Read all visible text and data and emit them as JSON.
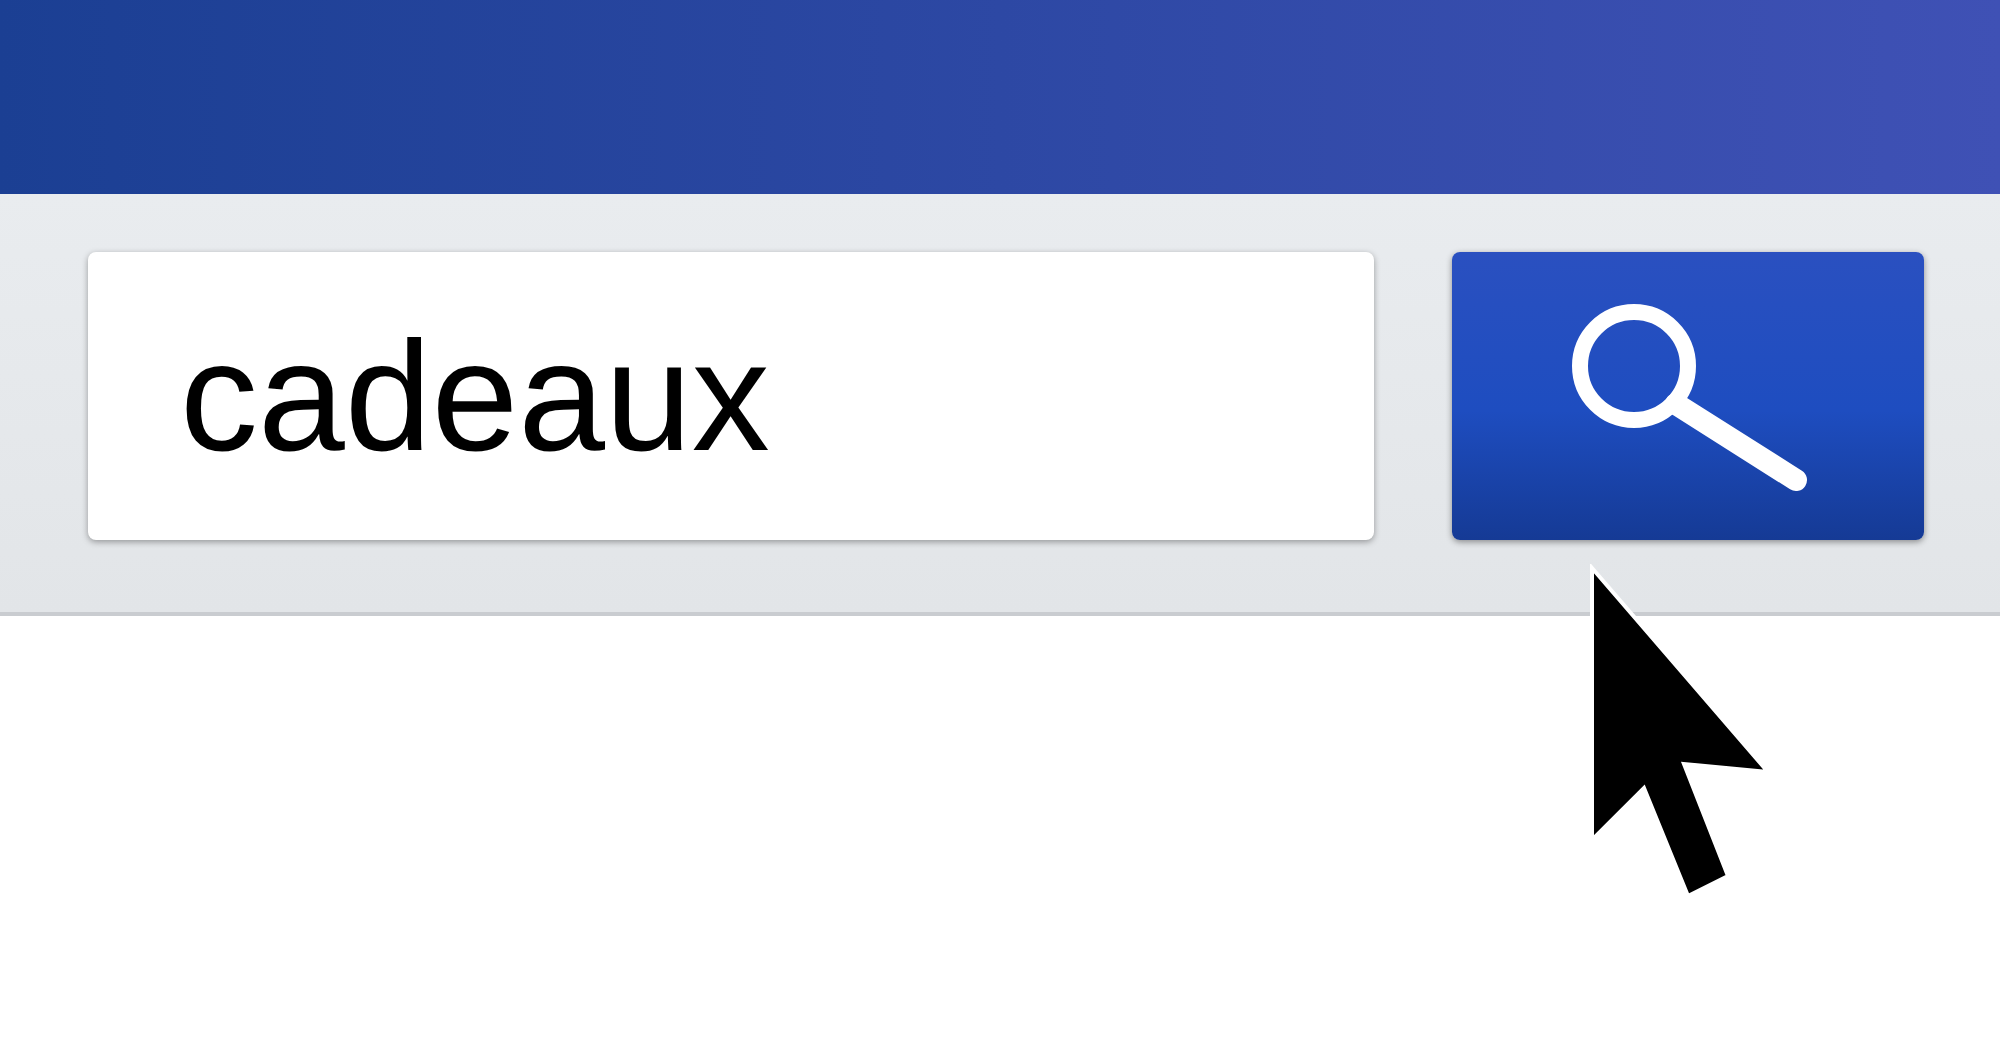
{
  "search_field": {
    "value": "cadeaux"
  }
}
